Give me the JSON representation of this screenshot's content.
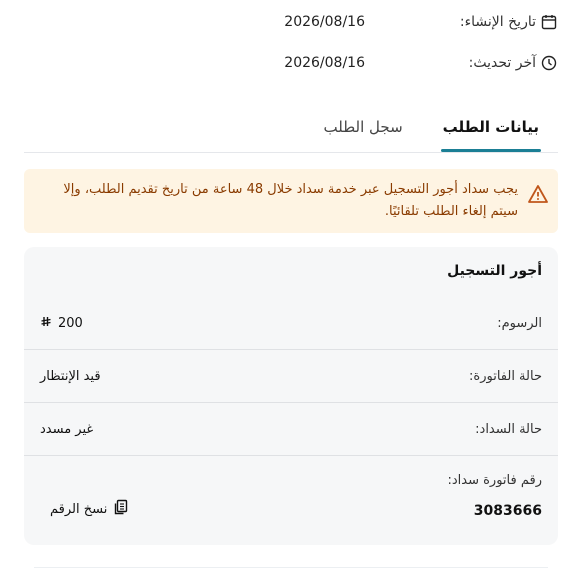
{
  "meta": {
    "created_label": "تاريخ الإنشاء:",
    "created_value": "2026/08/16",
    "updated_label": "آخر تحديث:",
    "updated_value": "2026/08/16",
    "created_icon": "calendar-icon",
    "updated_icon": "clock-icon"
  },
  "tabs": [
    {
      "label": "بيانات الطلب",
      "active": true
    },
    {
      "label": "سجل الطلب",
      "active": false
    }
  ],
  "alert": {
    "icon": "warning-icon",
    "message": "يجب سداد أجور التسجيل عبر خدمة سداد خلال 48 ساعة من تاريخ تقديم الطلب، وإلا سيتم إلغاء الطلب تلقائيًا."
  },
  "card": {
    "title": "أجور التسجيل",
    "fees_label": "الرسوم:",
    "fees_value": "200",
    "fees_currency_icon": "riyal-icon",
    "invoice_status_label": "حالة الفاتورة:",
    "invoice_status_value": "قيد الإنتظار",
    "payment_status_label": "حالة السداد:",
    "payment_status_value": "غير مسدد",
    "invoice_number_label": "رقم فاتورة سداد:",
    "invoice_number_value": "3083666",
    "copy_label": "نسخ الرقم",
    "copy_icon": "copy-icon"
  },
  "colors": {
    "accent": "#1b7f95",
    "alert_bg": "#fef4e3",
    "alert_text": "#8a3b00",
    "card_bg": "#f6f7f8"
  }
}
